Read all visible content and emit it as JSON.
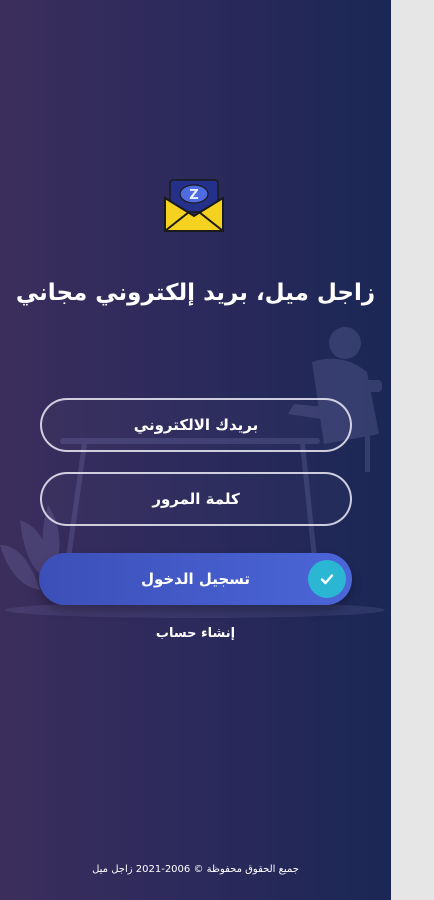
{
  "app": {
    "title": "زاجل ميل، بريد إلكتروني مجاني"
  },
  "form": {
    "email_label": "بريدك الالكتروني",
    "password_label": "كلمة المرور",
    "login_label": "تسجيل الدخول"
  },
  "links": {
    "create_account": "إنشاء حساب"
  },
  "footer": {
    "text": "جميع الحقوق محفوظة © 2006-2021 زاجل ميل"
  },
  "icons": {
    "logo": "envelope-logo-icon",
    "check": "check-icon"
  },
  "colors": {
    "panel_left": "#3b2e5c",
    "panel_right": "#1b2756",
    "button": "#4b66d8",
    "check_circle": "#2bb7d3",
    "logo_envelope": "#f5d21f"
  }
}
